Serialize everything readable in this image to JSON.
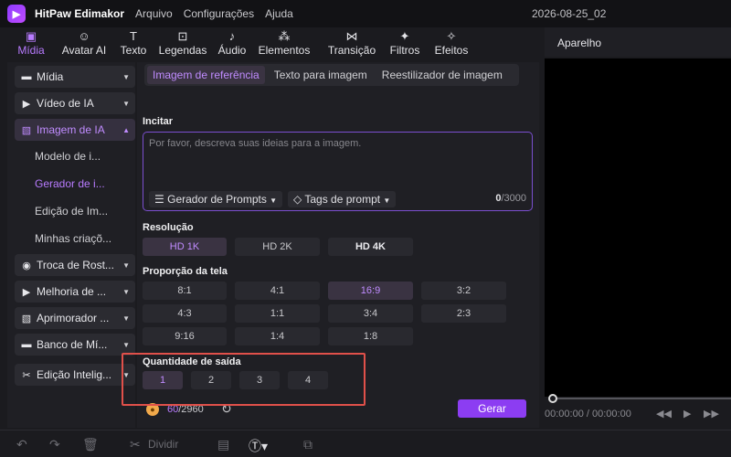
{
  "titlebar": {
    "app_name": "HitPaw Edimakor",
    "menus": [
      "Arquivo",
      "Configurações",
      "Ajuda"
    ],
    "date": "2026-08-25_02"
  },
  "toolbar": {
    "tabs": [
      {
        "label": "Mídia",
        "icon": "media-icon"
      },
      {
        "label": "Avatar AI",
        "icon": "avatar-icon"
      },
      {
        "label": "Texto",
        "icon": "text-icon"
      },
      {
        "label": "Legendas",
        "icon": "captions-icon"
      },
      {
        "label": "Áudio",
        "icon": "music-icon"
      },
      {
        "label": "Elementos",
        "icon": "elements-icon"
      },
      {
        "label": "Transição",
        "icon": "transition-icon"
      },
      {
        "label": "Filtros",
        "icon": "filter-icon"
      },
      {
        "label": "Efeitos",
        "icon": "effects-icon"
      }
    ]
  },
  "sidebar": {
    "items": [
      {
        "label": "Mídia"
      },
      {
        "label": "Vídeo de IA"
      },
      {
        "label": "Imagem de IA"
      },
      {
        "label": "Troca de Rost..."
      },
      {
        "label": "Melhoria de ..."
      },
      {
        "label": "Aprimorador ..."
      },
      {
        "label": "Banco de Mí..."
      },
      {
        "label": "Edição Intelig..."
      }
    ],
    "subitems": [
      {
        "label": "Modelo de i..."
      },
      {
        "label": "Gerador de i..."
      },
      {
        "label": "Edição de Im..."
      },
      {
        "label": "Minhas criaçõ..."
      }
    ]
  },
  "main": {
    "tabs": [
      "Imagem de referência",
      "Texto para imagem",
      "Reestilizador de imagem"
    ],
    "prompt": {
      "label": "Incitar",
      "placeholder": "Por favor, descreva suas ideias para a imagem.",
      "generator_label": "Gerador de Prompts",
      "tags_label": "Tags de prompt",
      "count": "0",
      "max": "/3000"
    },
    "resolution": {
      "label": "Resolução",
      "options": [
        "HD 1K",
        "HD 2K",
        "HD 4K"
      ]
    },
    "aspect": {
      "label": "Proporção da tela",
      "options": [
        "8:1",
        "4:1",
        "16:9",
        "3:2",
        "4:3",
        "1:1",
        "3:4",
        "2:3",
        "9:16",
        "1:4",
        "1:8"
      ]
    },
    "quantity": {
      "label": "Quantidade de saída",
      "options": [
        "1",
        "2",
        "3",
        "4"
      ]
    },
    "footer": {
      "credits_used": "60",
      "credits_total": "/2960",
      "generate_label": "Gerar"
    }
  },
  "preview": {
    "title": "Aparelho",
    "time": "00:00:00 / 00:00:00"
  },
  "bottombar": {
    "split_label": "Dividir"
  },
  "colors": {
    "accent": "#b87bff",
    "generate_button": "#8c3df2",
    "highlight_frame": "#e0504a"
  }
}
